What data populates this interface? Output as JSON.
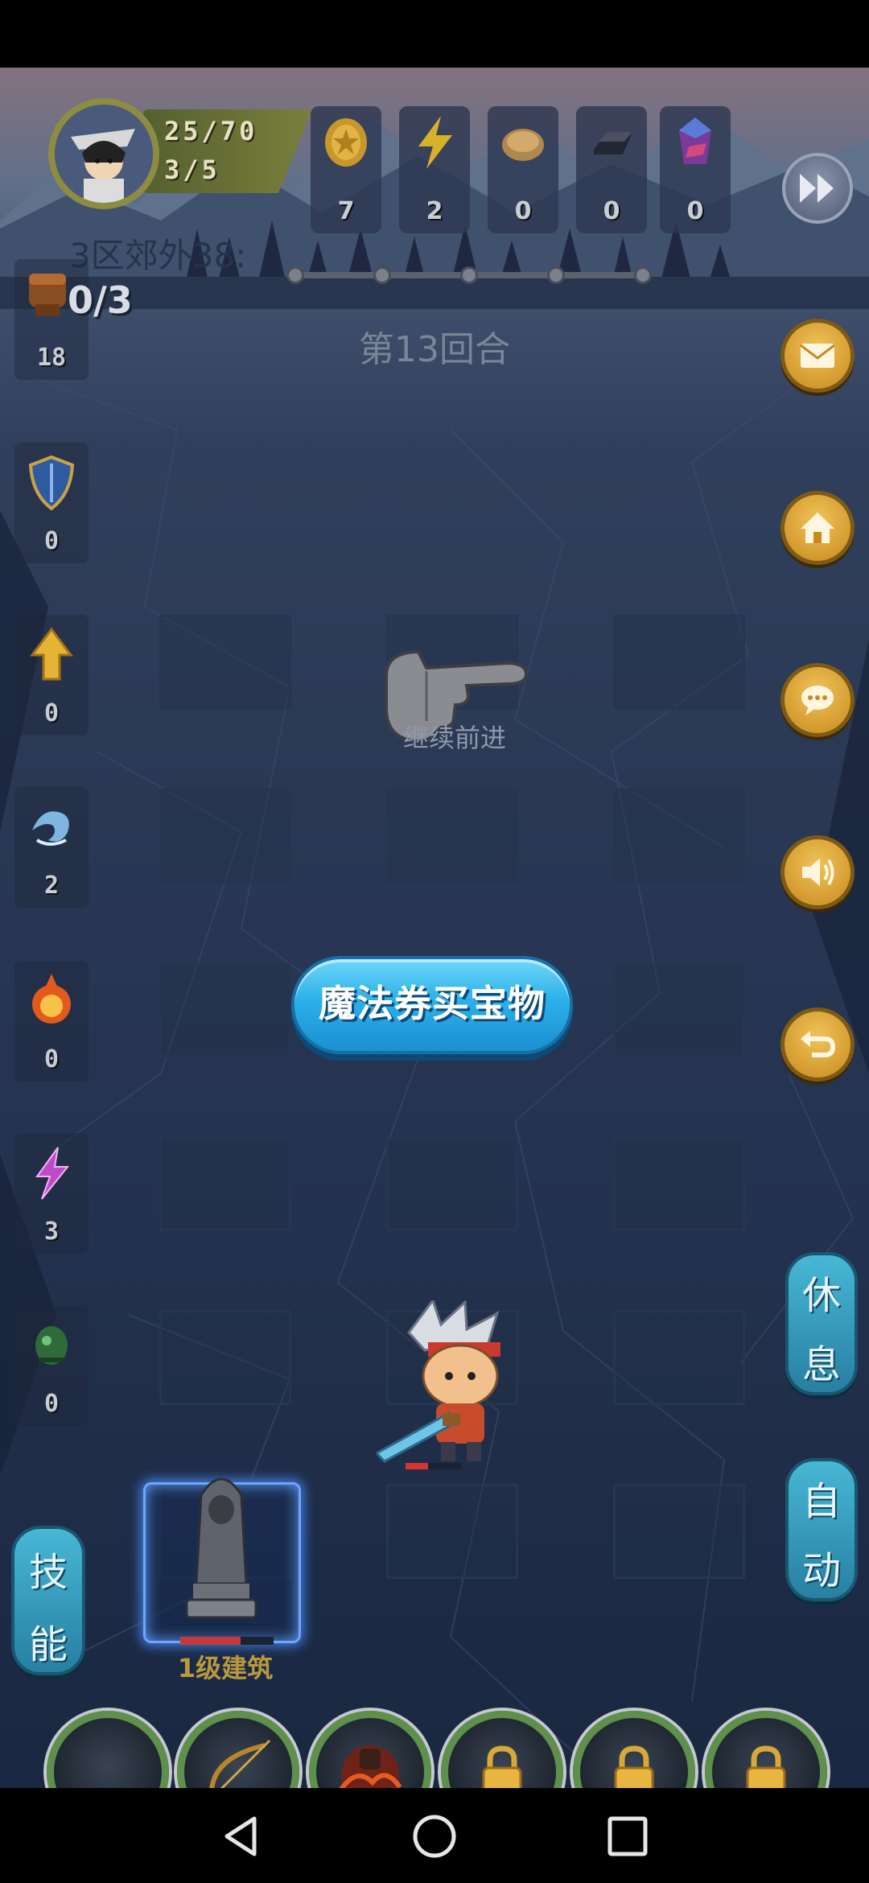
{
  "player": {
    "exp": "25/70",
    "stage": "3/5"
  },
  "resources": [
    {
      "name": "gold-coin",
      "value": "7"
    },
    {
      "name": "lightning",
      "value": "2"
    },
    {
      "name": "bread",
      "value": "0"
    },
    {
      "name": "iron-ingot",
      "value": "0"
    },
    {
      "name": "crystal",
      "value": "0"
    }
  ],
  "level": {
    "name": "3区郊外38:",
    "kills": "0/3",
    "round": "第13回合"
  },
  "side_items": [
    {
      "name": "fist",
      "value": "18"
    },
    {
      "name": "shield",
      "value": "0"
    },
    {
      "name": "arrow-up",
      "value": "0"
    },
    {
      "name": "water",
      "value": "2"
    },
    {
      "name": "fire",
      "value": "0"
    },
    {
      "name": "lightning-bolt",
      "value": "3"
    },
    {
      "name": "poison",
      "value": "0"
    }
  ],
  "hint": {
    "continue": "继续前进"
  },
  "buttons": {
    "buy_treasure": "魔法券买宝物",
    "rest": [
      "休",
      "息"
    ],
    "auto": [
      "自",
      "动"
    ],
    "skill": [
      "技",
      "能"
    ]
  },
  "building": {
    "label": "1级建筑",
    "hp": 0.65
  },
  "hero": {
    "hp": 0.4
  },
  "colors": {
    "accent_gold": "#e0a83a",
    "button_blue": "#2cb0ea",
    "pill_blue": "#3aa0c4"
  }
}
